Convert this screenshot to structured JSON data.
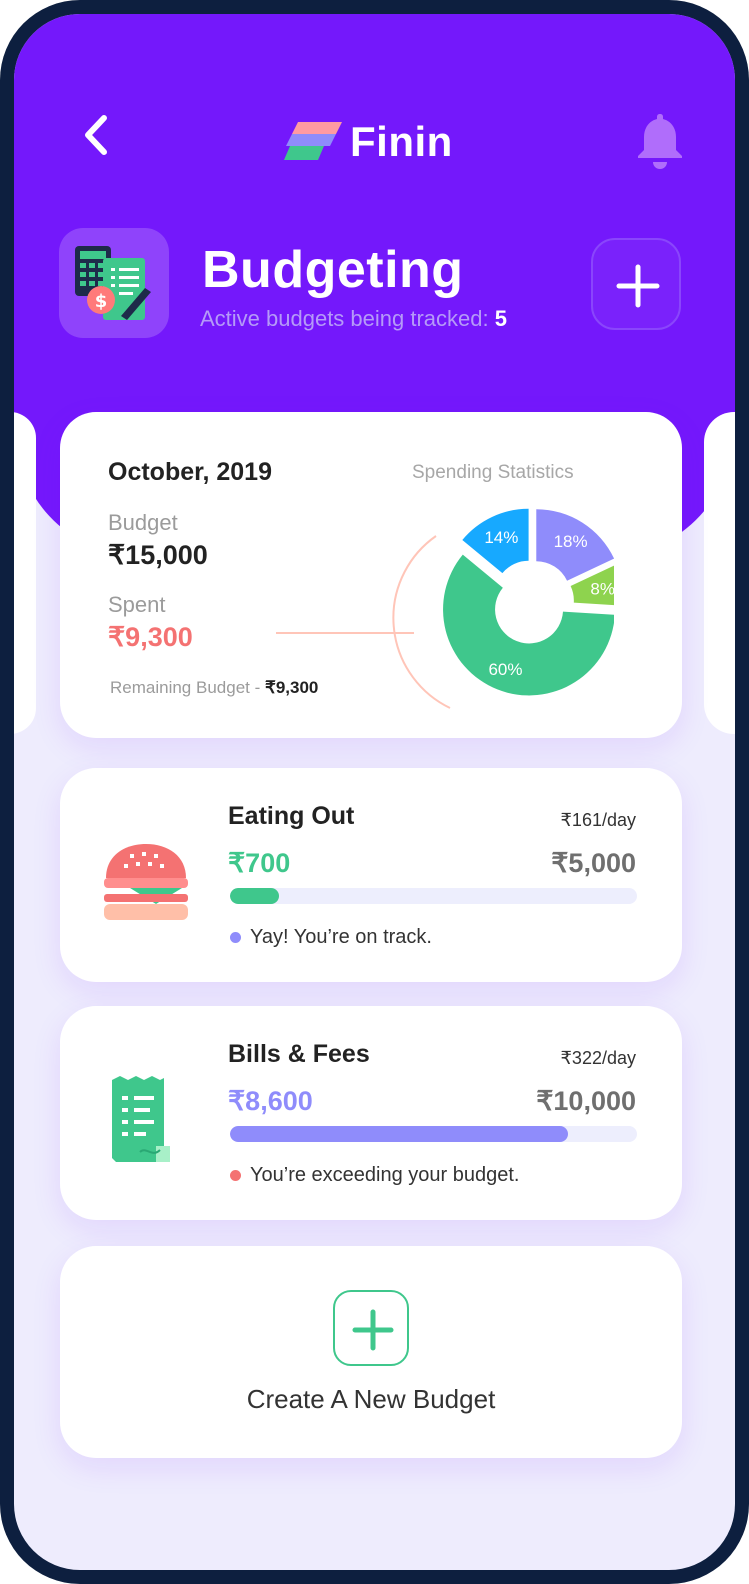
{
  "header": {
    "brand": "Finin",
    "icons": [
      "back-arrow-icon",
      "finin-logo-icon",
      "bell-icon"
    ]
  },
  "page": {
    "title": "Budgeting",
    "subtitle_prefix": "Active budgets being tracked:",
    "active_count": "5",
    "add_icon": "plus-icon"
  },
  "summary": {
    "month": "October, 2019",
    "stats_title": "Spending Statistics",
    "budget_label": "Budget",
    "budget_value": "₹15,000",
    "spent_label": "Spent",
    "spent_value": "₹9,300",
    "remaining_label": "Remaining Budget -",
    "remaining_value": "₹9,300"
  },
  "chart_data": {
    "type": "pie",
    "title": "Spending Statistics",
    "slices": [
      {
        "label": "18%",
        "value": 18,
        "color": "#8f8cfb"
      },
      {
        "label": "8%",
        "value": 8,
        "color": "#8ed34e"
      },
      {
        "label": "60%",
        "value": 60,
        "color": "#3fc78c"
      },
      {
        "label": "14%",
        "value": 14,
        "color": "#17a9ff"
      }
    ]
  },
  "budgets": [
    {
      "name": "Eating Out",
      "rate": "₹161/day",
      "spent": "₹700",
      "total": "₹5,000",
      "progress": 0.12,
      "fill_color": "#3fc78c",
      "spent_color": "#3fc78c",
      "status": "Yay! You’re on track.",
      "status_color": "#8f8cfb",
      "icon": "burger-icon"
    },
    {
      "name": "Bills & Fees",
      "rate": "₹322/day",
      "spent": "₹8,600",
      "total": "₹10,000",
      "progress": 0.83,
      "fill_color": "#8f8cfb",
      "spent_color": "#8f8cfb",
      "status": "You’re exceeding your budget.",
      "status_color": "#f47272",
      "icon": "receipt-icon"
    }
  ],
  "create": {
    "label": "Create A New Budget",
    "icon": "plus-icon"
  },
  "colors": {
    "primary": "#7418fb",
    "accent_green": "#3fc78c",
    "accent_red": "#f47272",
    "accent_purple": "#8f8cfb"
  }
}
